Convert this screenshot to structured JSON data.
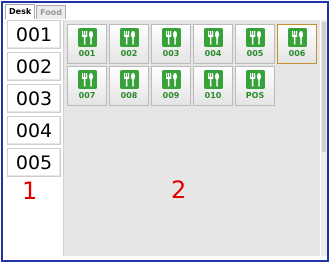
{
  "tabs": [
    {
      "label": "Desk",
      "active": true
    },
    {
      "label": "Food",
      "active": false
    }
  ],
  "left_items": [
    "001",
    "002",
    "003",
    "004",
    "005"
  ],
  "left_panel_number": "1",
  "right_panel_number": "2",
  "tiles": [
    {
      "label": "001",
      "selected": false
    },
    {
      "label": "002",
      "selected": false
    },
    {
      "label": "003",
      "selected": false
    },
    {
      "label": "004",
      "selected": false
    },
    {
      "label": "005",
      "selected": false
    },
    {
      "label": "006",
      "selected": true
    },
    {
      "label": "007",
      "selected": false
    },
    {
      "label": "008",
      "selected": false
    },
    {
      "label": "009",
      "selected": false
    },
    {
      "label": "010",
      "selected": false
    },
    {
      "label": "POS",
      "selected": false
    }
  ],
  "tile_icon": "fork-knife-icon",
  "colors": {
    "border": "#2233a8",
    "panel_number": "#e00000",
    "icon_green": "#37a13a",
    "tile_label": "#2b8a2b",
    "selected_border": "#c49030"
  }
}
